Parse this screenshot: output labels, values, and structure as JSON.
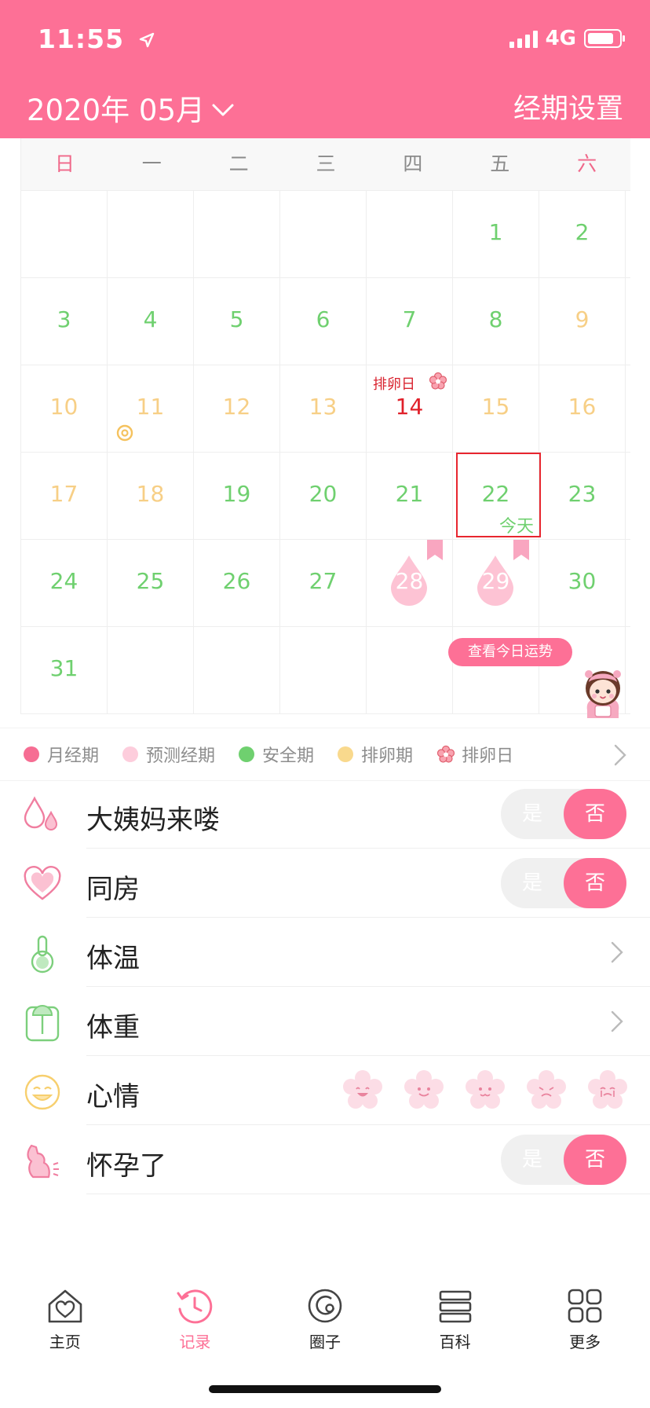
{
  "status": {
    "time": "11:55",
    "network": "4G"
  },
  "header": {
    "month": "2020年 05月",
    "settings": "经期设置"
  },
  "calendar": {
    "weekdays": [
      "日",
      "一",
      "二",
      "三",
      "四",
      "五",
      "六"
    ],
    "ovulation_label": "排卵日",
    "today_label": "今天",
    "fortune_button": "查看今日运势",
    "days": [
      {
        "n": "1",
        "t": "green"
      },
      {
        "n": "2",
        "t": "green"
      },
      {
        "n": "3",
        "t": "green"
      },
      {
        "n": "4",
        "t": "green"
      },
      {
        "n": "5",
        "t": "green"
      },
      {
        "n": "6",
        "t": "green"
      },
      {
        "n": "7",
        "t": "green"
      },
      {
        "n": "8",
        "t": "green"
      },
      {
        "n": "9",
        "t": "yellow"
      },
      {
        "n": "10",
        "t": "yellow"
      },
      {
        "n": "11",
        "t": "yellow"
      },
      {
        "n": "12",
        "t": "yellow"
      },
      {
        "n": "13",
        "t": "yellow"
      },
      {
        "n": "14",
        "t": "red"
      },
      {
        "n": "15",
        "t": "yellow"
      },
      {
        "n": "16",
        "t": "yellow"
      },
      {
        "n": "17",
        "t": "yellow"
      },
      {
        "n": "18",
        "t": "yellow"
      },
      {
        "n": "19",
        "t": "green"
      },
      {
        "n": "20",
        "t": "green"
      },
      {
        "n": "21",
        "t": "green"
      },
      {
        "n": "22",
        "t": "green"
      },
      {
        "n": "23",
        "t": "green"
      },
      {
        "n": "24",
        "t": "green"
      },
      {
        "n": "25",
        "t": "green"
      },
      {
        "n": "26",
        "t": "green"
      },
      {
        "n": "27",
        "t": "green"
      },
      {
        "n": "28",
        "t": "drop"
      },
      {
        "n": "29",
        "t": "drop"
      },
      {
        "n": "30",
        "t": "green"
      },
      {
        "n": "31",
        "t": "green"
      }
    ]
  },
  "legend": [
    {
      "label": "月经期",
      "color": "#f66d93"
    },
    {
      "label": "预测经期",
      "color": "#fdcddc"
    },
    {
      "label": "安全期",
      "color": "#6fd06f"
    },
    {
      "label": "排卵期",
      "color": "#f9d98d"
    },
    {
      "label": "排卵日",
      "color": "#f77a8d"
    }
  ],
  "records": {
    "period": {
      "label": "大姨妈来喽",
      "yes": "是",
      "no": "否"
    },
    "intimacy": {
      "label": "同房",
      "yes": "是",
      "no": "否"
    },
    "temperature": {
      "label": "体温"
    },
    "weight": {
      "label": "体重"
    },
    "mood": {
      "label": "心情"
    },
    "pregnant": {
      "label": "怀孕了",
      "yes": "是",
      "no": "否"
    }
  },
  "tabs": [
    {
      "label": "主页"
    },
    {
      "label": "记录"
    },
    {
      "label": "圈子"
    },
    {
      "label": "百科"
    },
    {
      "label": "更多"
    }
  ],
  "colors": {
    "brand": "#fd7096",
    "green": "#6fd06f",
    "yellow": "#f7cf86",
    "red": "#e0202a"
  }
}
